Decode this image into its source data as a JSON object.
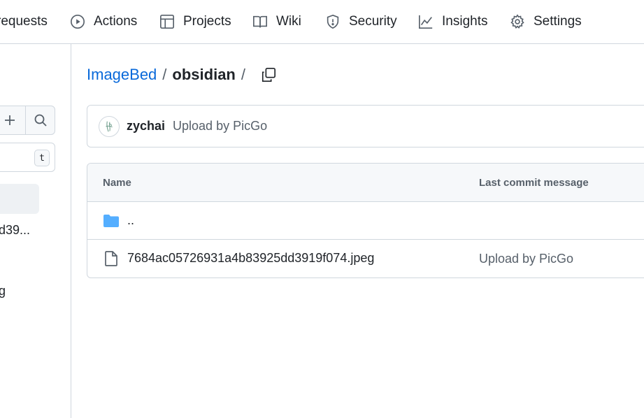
{
  "topnav": {
    "items": [
      {
        "label": "requests",
        "icon": "pull-request-icon"
      },
      {
        "label": "Actions",
        "icon": "play-circle-icon"
      },
      {
        "label": "Projects",
        "icon": "table-icon"
      },
      {
        "label": "Wiki",
        "icon": "book-icon"
      },
      {
        "label": "Security",
        "icon": "shield-icon"
      },
      {
        "label": "Insights",
        "icon": "graph-icon"
      },
      {
        "label": "Settings",
        "icon": "gear-icon"
      }
    ]
  },
  "sidebar": {
    "filter_shortcut": "t",
    "files": [
      "d39...",
      "g"
    ]
  },
  "breadcrumb": {
    "repo": "ImageBed",
    "separator": "/",
    "current": "obsidian"
  },
  "commit": {
    "author": "zychai",
    "message": "Upload by PicGo"
  },
  "table": {
    "headers": {
      "name": "Name",
      "last_commit": "Last commit message"
    },
    "rows": [
      {
        "name": "..",
        "type": "parent-dir",
        "message": ""
      },
      {
        "name": "7684ac05726931a4b83925dd3919f074.jpeg",
        "type": "file",
        "message": "Upload by PicGo"
      }
    ]
  },
  "colors": {
    "link": "#0969da",
    "folder": "#54aeff",
    "border": "#d0d7de"
  }
}
